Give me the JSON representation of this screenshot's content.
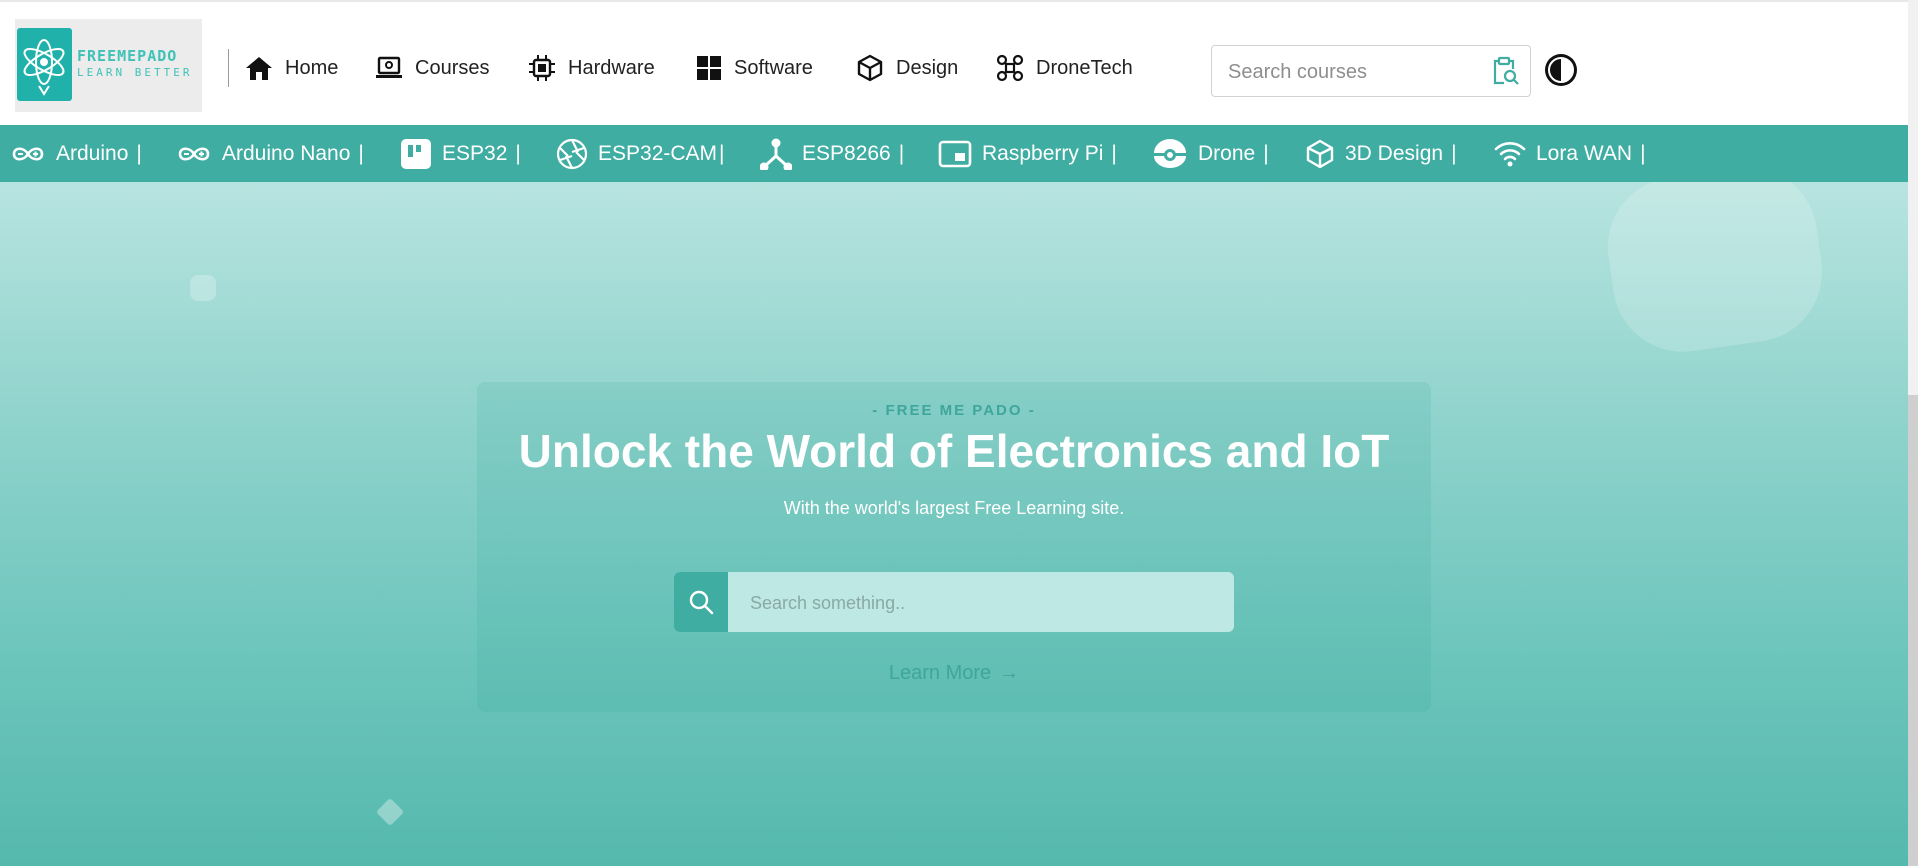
{
  "brand": {
    "line1": "FREEMEPADO",
    "line2": "LEARN BETTER"
  },
  "nav": [
    {
      "label": "Home",
      "icon": "home-icon"
    },
    {
      "label": "Courses",
      "icon": "laptop-icon"
    },
    {
      "label": "Hardware",
      "icon": "chip-icon"
    },
    {
      "label": "Software",
      "icon": "grid-icon"
    },
    {
      "label": "Design",
      "icon": "cube-icon"
    },
    {
      "label": "DroneTech",
      "icon": "drone-icon"
    }
  ],
  "header_search": {
    "placeholder": "Search courses"
  },
  "categories": [
    {
      "label": "Arduino",
      "icon": "infinity-icon",
      "sep": "|"
    },
    {
      "label": "Arduino Nano",
      "icon": "infinity-icon",
      "sep": "|"
    },
    {
      "label": "ESP32",
      "icon": "board-icon",
      "sep": "|"
    },
    {
      "label": "ESP32-CAM",
      "icon": "aperture-icon",
      "sep": "|"
    },
    {
      "label": "ESP8266",
      "icon": "nodes-icon",
      "sep": "|"
    },
    {
      "label": "Raspberry Pi",
      "icon": "picture-in-picture-icon",
      "sep": "|"
    },
    {
      "label": "Drone",
      "icon": "drone-eye-icon",
      "sep": "|"
    },
    {
      "label": "3D Design",
      "icon": "cube-icon",
      "sep": "|"
    },
    {
      "label": "Lora WAN",
      "icon": "wifi-icon",
      "sep": "|"
    }
  ],
  "hero": {
    "eyebrow": "- FREE ME PADO -",
    "title": "Unlock the World of Electronics and IoT",
    "subtitle": "With the world's largest Free Learning site.",
    "search_placeholder": "Search something..",
    "cta": "Learn More",
    "cta_arrow": "→"
  },
  "colors": {
    "accent": "#3fada2",
    "hero_top": "#b8e4e0",
    "hero_bottom": "#55b9ae"
  }
}
